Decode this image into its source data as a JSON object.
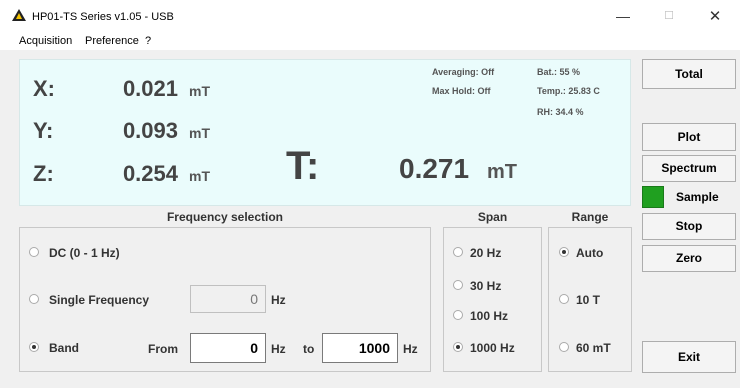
{
  "window": {
    "title": "HP01-TS Series v1.05 - USB",
    "minimize": "—",
    "maximize": "☐",
    "close": "✕"
  },
  "menu": {
    "items": [
      "Acquisition",
      "Preference",
      "?"
    ]
  },
  "readout": {
    "axes": [
      {
        "label": "X:",
        "value": "0.021",
        "unit": "mT"
      },
      {
        "label": "Y:",
        "value": "0.093",
        "unit": "mT"
      },
      {
        "label": "Z:",
        "value": "0.254",
        "unit": "mT"
      }
    ],
    "total": {
      "label": "T:",
      "value": "0.271",
      "unit": "mT"
    },
    "status": {
      "averaging": "Averaging: Off",
      "max_hold": "Max Hold: Off",
      "battery": "Bat.: 55 %",
      "temperature": "Temp.: 25.83 C",
      "humidity": "RH: 34.4 %"
    }
  },
  "buttons": {
    "total": "Total",
    "plot": "Plot",
    "spectrum": "Spectrum",
    "sample": "Sample",
    "stop": "Stop",
    "zero": "Zero",
    "exit": "Exit"
  },
  "colors": {
    "panel_bg": "#eafcfc",
    "sample_indicator": "#20a020"
  },
  "frequency": {
    "title": "Frequency selection",
    "options": [
      {
        "label": "DC (0 - 1 Hz)",
        "selected": false
      },
      {
        "label": "Single Frequency",
        "selected": false
      },
      {
        "label": "Band",
        "selected": true
      }
    ],
    "single_value": "0",
    "single_unit": "Hz",
    "band": {
      "from_label": "From",
      "from_value": "0",
      "from_unit": "Hz",
      "to_label": "to",
      "to_value": "1000",
      "to_unit": "Hz"
    }
  },
  "span": {
    "title": "Span",
    "options": [
      {
        "label": "20 Hz",
        "selected": false
      },
      {
        "label": "30 Hz",
        "selected": false
      },
      {
        "label": "100 Hz",
        "selected": false
      },
      {
        "label": "1000 Hz",
        "selected": true
      }
    ]
  },
  "range": {
    "title": "Range",
    "options": [
      {
        "label": "Auto",
        "selected": true
      },
      {
        "label": "10 T",
        "selected": false
      },
      {
        "label": "60 mT",
        "selected": false
      }
    ]
  }
}
